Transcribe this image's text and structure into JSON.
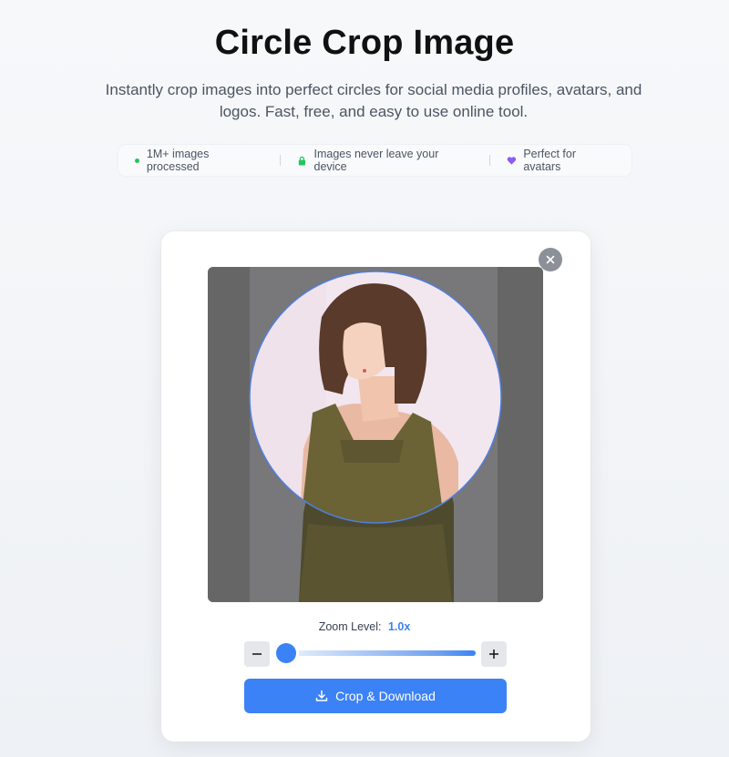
{
  "hero": {
    "title": "Circle Crop Image",
    "subtitle": "Instantly crop images into perfect circles for social media profiles, avatars, and logos. Fast, free, and easy to use online tool."
  },
  "features": [
    {
      "icon": "dot-icon",
      "label": "1M+ images processed",
      "color": "#22c55e"
    },
    {
      "icon": "lock-icon",
      "label": "Images never leave your device",
      "color": "#22c55e"
    },
    {
      "icon": "heart-icon",
      "label": "Perfect for avatars",
      "color": "#8b5cf6"
    }
  ],
  "editor": {
    "close_icon": "close-icon",
    "zoom_label": "Zoom Level:",
    "zoom_value": "1.0x",
    "zoom_level_fraction": 0.0,
    "download_label": "Crop & Download",
    "accent": "#3b82f6"
  }
}
